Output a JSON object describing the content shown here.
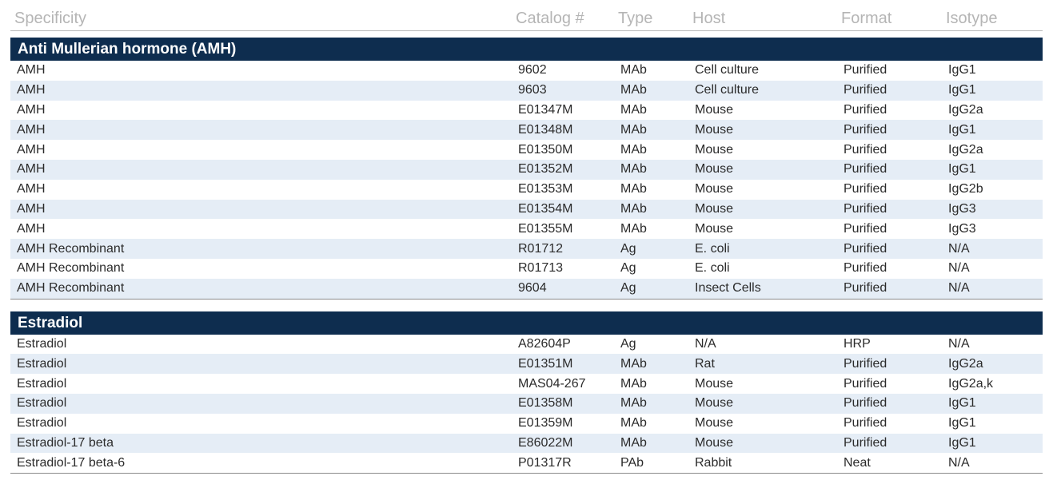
{
  "columns": [
    "Specificity",
    "Catalog #",
    "Type",
    "Host",
    "Format",
    "Isotype"
  ],
  "sections": [
    {
      "title": "Anti Mullerian hormone (AMH)",
      "rows": [
        [
          "AMH",
          "9602",
          "MAb",
          "Cell culture",
          "Purified",
          "IgG1"
        ],
        [
          "AMH",
          "9603",
          "MAb",
          "Cell culture",
          "Purified",
          "IgG1"
        ],
        [
          "AMH",
          "E01347M",
          "MAb",
          "Mouse",
          "Purified",
          "IgG2a"
        ],
        [
          "AMH",
          "E01348M",
          "MAb",
          "Mouse",
          "Purified",
          "IgG1"
        ],
        [
          "AMH",
          "E01350M",
          "MAb",
          "Mouse",
          "Purified",
          "IgG2a"
        ],
        [
          "AMH",
          "E01352M",
          "MAb",
          "Mouse",
          "Purified",
          "IgG1"
        ],
        [
          "AMH",
          "E01353M",
          "MAb",
          "Mouse",
          "Purified",
          "IgG2b"
        ],
        [
          "AMH",
          "E01354M",
          "MAb",
          "Mouse",
          "Purified",
          "IgG3"
        ],
        [
          "AMH",
          "E01355M",
          "MAb",
          "Mouse",
          "Purified",
          "IgG3"
        ],
        [
          "AMH Recombinant",
          "R01712",
          "Ag",
          "E. coli",
          "Purified",
          "N/A"
        ],
        [
          "AMH Recombinant",
          "R01713",
          "Ag",
          "E. coli",
          "Purified",
          "N/A"
        ],
        [
          "AMH Recombinant",
          "9604",
          "Ag",
          "Insect Cells",
          "Purified",
          "N/A"
        ]
      ]
    },
    {
      "title": "Estradiol",
      "rows": [
        [
          "Estradiol",
          "A82604P",
          "Ag",
          "N/A",
          "HRP",
          "N/A"
        ],
        [
          "Estradiol",
          "E01351M",
          "MAb",
          "Rat",
          "Purified",
          "IgG2a"
        ],
        [
          "Estradiol",
          "MAS04-267",
          "MAb",
          "Mouse",
          "Purified",
          "IgG2a,k"
        ],
        [
          "Estradiol",
          "E01358M",
          "MAb",
          "Mouse",
          "Purified",
          "IgG1"
        ],
        [
          "Estradiol",
          "E01359M",
          "MAb",
          "Mouse",
          "Purified",
          "IgG1"
        ],
        [
          "Estradiol-17 beta",
          "E86022M",
          "MAb",
          "Mouse",
          "Purified",
          "IgG1"
        ],
        [
          "Estradiol-17 beta-6",
          "P01317R",
          "PAb",
          "Rabbit",
          "Neat",
          "N/A"
        ]
      ]
    }
  ]
}
